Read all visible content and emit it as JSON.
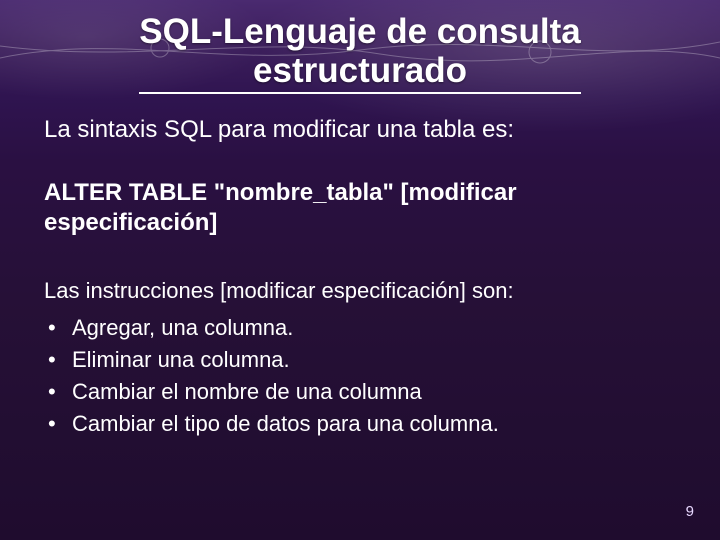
{
  "title_line1": "SQL-Lenguaje de consulta",
  "title_line2": "estructurado",
  "intro": "La sintaxis SQL para modificar una tabla es:",
  "syntax": "ALTER TABLE \"nombre_tabla\" [modificar especificación]",
  "list_intro": "Las instrucciones [modificar especificación] son:",
  "bullets": [
    "Agregar, una columna.",
    "Eliminar una columna.",
    "Cambiar el nombre de una columna",
    "Cambiar el tipo de datos para una columna."
  ],
  "page_number": "9"
}
